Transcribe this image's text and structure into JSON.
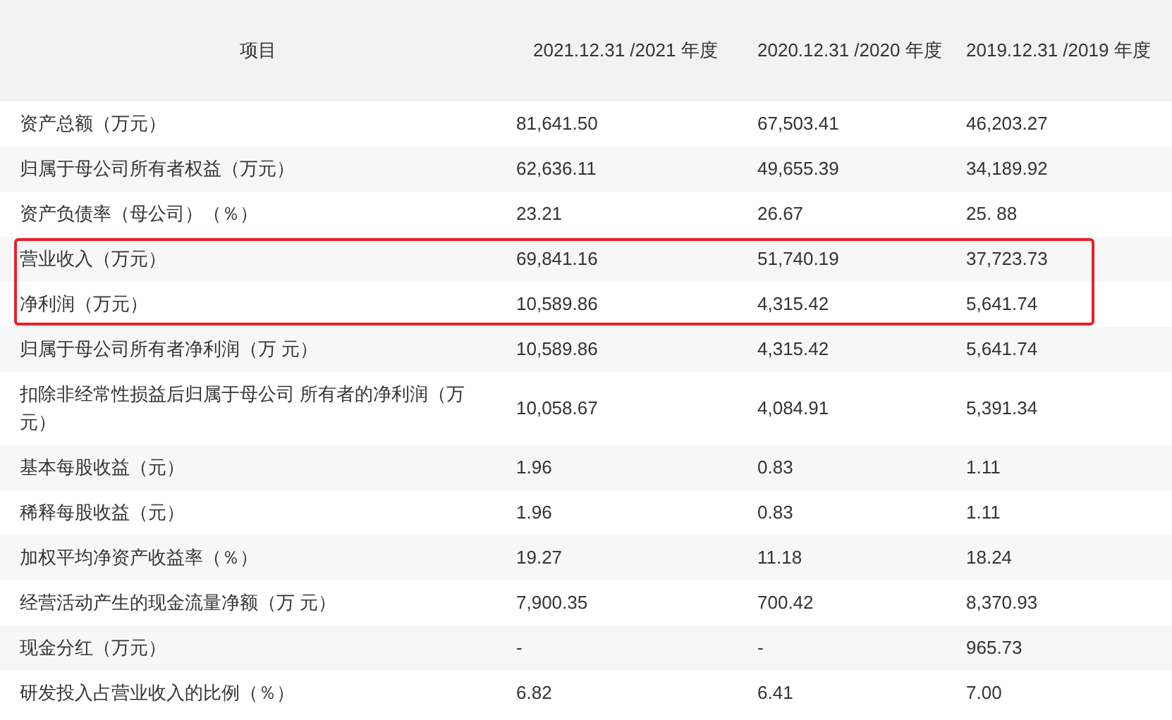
{
  "table": {
    "columns": [
      "项目",
      "2021.12.31 /2021 年度",
      "2020.12.31 /2020 年度",
      "2019.12.31 /2019 年度"
    ],
    "rows": [
      {
        "cells": [
          "资产总额（万元）",
          "81,641.50",
          "67,503.41",
          "46,203.27"
        ],
        "highlighted": false
      },
      {
        "cells": [
          "归属于母公司所有者权益（万元）",
          "62,636.11",
          "49,655.39",
          "34,189.92"
        ],
        "highlighted": false
      },
      {
        "cells": [
          "资产负债率（母公司）（％）",
          "23.21",
          "26.67",
          "25. 88"
        ],
        "highlighted": false
      },
      {
        "cells": [
          "营业收入（万元）",
          "69,841.16",
          "51,740.19",
          "37,723.73"
        ],
        "highlighted": true
      },
      {
        "cells": [
          "净利润（万元）",
          "10,589.86",
          "4,315.42",
          "5,641.74"
        ],
        "highlighted": true
      },
      {
        "cells": [
          "归属于母公司所有者净利润（万 元）",
          "10,589.86",
          "4,315.42",
          "5,641.74"
        ],
        "highlighted": false
      },
      {
        "cells": [
          "扣除非经常性损益后归属于母公司 所有者的净利润（万元）",
          "10,058.67",
          "4,084.91",
          "5,391.34"
        ],
        "highlighted": false
      },
      {
        "cells": [
          "基本每股收益（元）",
          "1.96",
          "0.83",
          "1.11"
        ],
        "highlighted": false
      },
      {
        "cells": [
          "稀释每股收益（元）",
          "1.96",
          "0.83",
          "1.11"
        ],
        "highlighted": false
      },
      {
        "cells": [
          "加权平均净资产收益率（％）",
          "19.27",
          "11.18",
          "18.24"
        ],
        "highlighted": false
      },
      {
        "cells": [
          "经营活动产生的现金流量净额（万 元）",
          "7,900.35",
          "700.42",
          "8,370.93"
        ],
        "highlighted": false
      },
      {
        "cells": [
          "现金分红（万元）",
          "-",
          "-",
          "965.73"
        ],
        "highlighted": false
      },
      {
        "cells": [
          "研发投入占营业收入的比例（％）",
          "6.82",
          "6.41",
          "7.00"
        ],
        "highlighted": false
      }
    ]
  }
}
